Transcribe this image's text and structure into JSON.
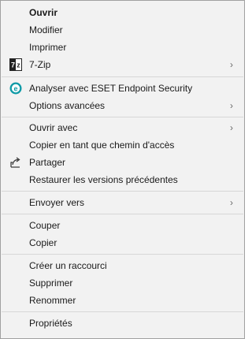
{
  "menu": {
    "items": [
      {
        "label": "Ouvrir"
      },
      {
        "label": "Modifier"
      },
      {
        "label": "Imprimer"
      },
      {
        "label": "7-Zip"
      },
      {
        "label": "Analyser avec ESET Endpoint Security"
      },
      {
        "label": "Options avancées"
      },
      {
        "label": "Ouvrir avec"
      },
      {
        "label": "Copier en tant que chemin d'accès"
      },
      {
        "label": "Partager"
      },
      {
        "label": "Restaurer les versions précédentes"
      },
      {
        "label": "Envoyer vers"
      },
      {
        "label": "Couper"
      },
      {
        "label": "Copier"
      },
      {
        "label": "Créer un raccourci"
      },
      {
        "label": "Supprimer"
      },
      {
        "label": "Renommer"
      },
      {
        "label": "Propriétés"
      }
    ],
    "submenu_arrow": "›",
    "icons": {
      "zip": "7z-icon",
      "eset": "eset-icon",
      "share": "share-icon"
    },
    "eset_glyph": "e",
    "zip_glyph": "7z",
    "colors": {
      "background": "#f2f2f2",
      "separator": "#d7d7d7",
      "eset_accent": "#0d9aa6"
    }
  }
}
